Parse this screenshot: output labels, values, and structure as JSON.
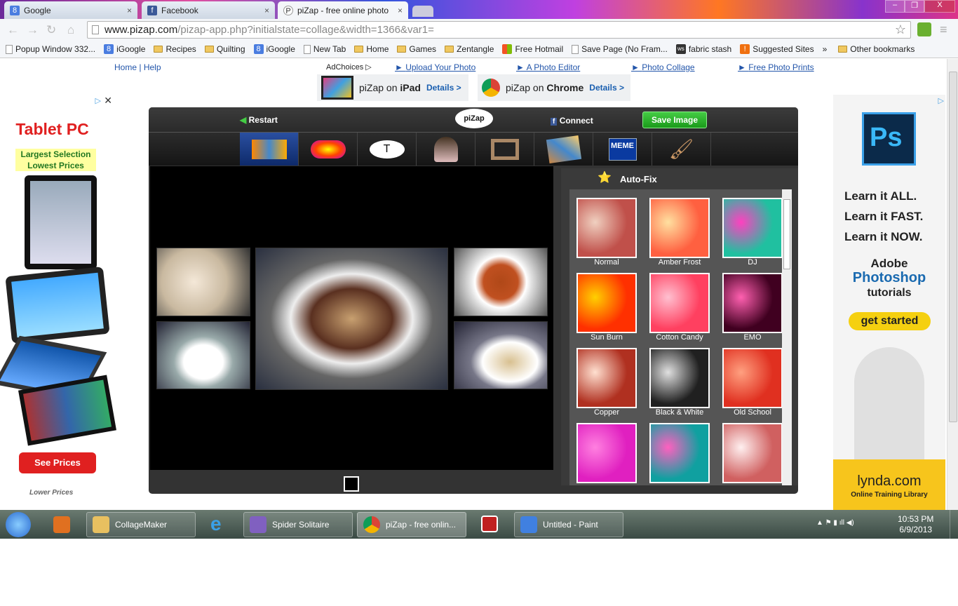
{
  "browser": {
    "tabs": [
      {
        "label": "Google",
        "icon": "google-icon"
      },
      {
        "label": "Facebook",
        "icon": "facebook-icon"
      },
      {
        "label": "piZap - free online photo",
        "icon": "pizap-icon",
        "active": true
      }
    ],
    "url_host": "www.pizap.com",
    "url_path": "/pizap-app.php?initialstate=collage&width=1366&var1=",
    "bookmarks": [
      {
        "label": "Popup Window 332...",
        "icon": "page"
      },
      {
        "label": "iGoogle",
        "icon": "google"
      },
      {
        "label": "Recipes",
        "icon": "folder"
      },
      {
        "label": "Quilting",
        "icon": "folder"
      },
      {
        "label": "iGoogle",
        "icon": "google"
      },
      {
        "label": "New Tab",
        "icon": "page"
      },
      {
        "label": "Home",
        "icon": "folder"
      },
      {
        "label": "Games",
        "icon": "folder"
      },
      {
        "label": "Zentangle",
        "icon": "folder"
      },
      {
        "label": "Free Hotmail",
        "icon": "windows"
      },
      {
        "label": "Save Page (No Fram...",
        "icon": "page"
      },
      {
        "label": "fabric stash",
        "icon": "ws"
      },
      {
        "label": "Suggested Sites",
        "icon": "bulb"
      }
    ],
    "overflow": "»",
    "other_bookmarks": "Other bookmarks"
  },
  "site": {
    "home": "Home",
    "sep": "|",
    "help": "Help",
    "adchoices": "AdChoices",
    "links": [
      "Upload Your Photo",
      "A Photo Editor",
      "Photo Collage",
      "Free Photo Prints"
    ],
    "promo_ipad": {
      "pre": "piZap on ",
      "bold": "iPad",
      "details": "Details >"
    },
    "promo_chrome": {
      "pre": "piZap on ",
      "bold": "Chrome",
      "details": "Details >"
    }
  },
  "left_ad": {
    "title": "Tablet PC",
    "line1": "Largest Selection",
    "line2": "Lowest Prices",
    "button": "See Prices",
    "footer": "Lower Prices"
  },
  "right_ad": {
    "logo": "Ps",
    "l1": "Learn it ALL.",
    "l2": "Learn it FAST.",
    "l3": "Learn it NOW.",
    "adobe": "Adobe",
    "photoshop": "Photoshop",
    "tutorials": "tutorials",
    "button": "get started",
    "brand": "lynda.com",
    "tagline": "Online Training Library"
  },
  "app": {
    "restart": "Restart",
    "logo": "piZap",
    "connect": "Connect",
    "save": "Save Image",
    "tools": [
      "collage",
      "stickers",
      "text",
      "cutout",
      "frames",
      "photos",
      "meme",
      "paint"
    ],
    "meme_label": "MEME",
    "text_label": "T",
    "autofix": "Auto-Fix",
    "filters": [
      {
        "name": "Normal",
        "c1": "#c0504a",
        "c2": "#f0d0c0"
      },
      {
        "name": "Amber Frost",
        "c1": "#ff6040",
        "c2": "#ffe0a0"
      },
      {
        "name": "DJ",
        "c1": "#20c0a0",
        "c2": "#ff40c0"
      },
      {
        "name": "Sun Burn",
        "c1": "#ff3000",
        "c2": "#ffd000"
      },
      {
        "name": "Cotton Candy",
        "c1": "#ff4060",
        "c2": "#ffc0d0"
      },
      {
        "name": "EMO",
        "c1": "#400020",
        "c2": "#ff60b0"
      },
      {
        "name": "Copper",
        "c1": "#b03020",
        "c2": "#ffe0d0"
      },
      {
        "name": "Black & White",
        "c1": "#202020",
        "c2": "#e0e0e0"
      },
      {
        "name": "Old School",
        "c1": "#e03020",
        "c2": "#ffa080"
      },
      {
        "name": "",
        "c1": "#e020c0",
        "c2": "#ff80e0"
      },
      {
        "name": "",
        "c1": "#10a0a0",
        "c2": "#ff60c0"
      },
      {
        "name": "",
        "c1": "#d06060",
        "c2": "#fff0f0"
      }
    ]
  },
  "taskbar": {
    "items": [
      {
        "label": "CollageMaker",
        "color": "#e8c060"
      },
      {
        "label": "Spider Solitaire",
        "color": "#8060c0"
      },
      {
        "label": "piZap - free onlin...",
        "color": "#e04030"
      },
      {
        "label": "Untitled - Paint",
        "color": "#4080e0"
      }
    ],
    "time": "10:53 PM",
    "date": "6/9/2013"
  }
}
